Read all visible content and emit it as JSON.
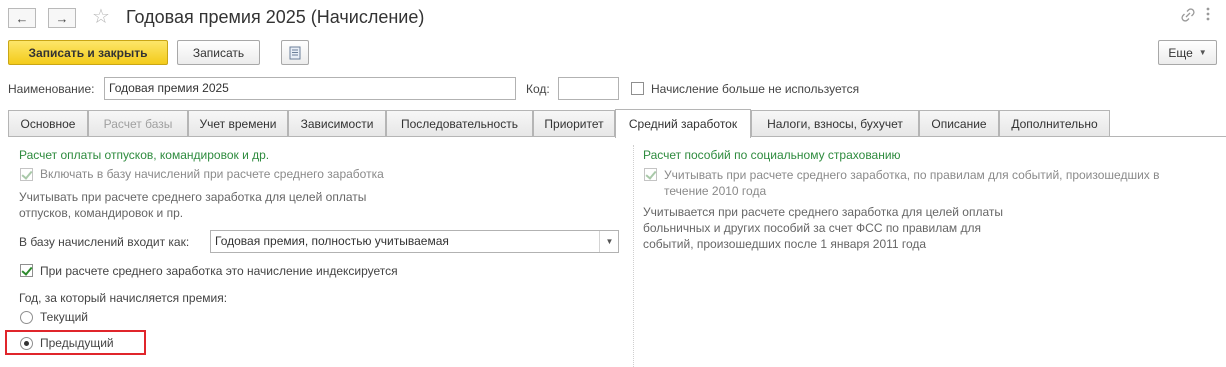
{
  "window": {
    "title": "Годовая премия 2025 (Начисление)",
    "icons": [
      "arrow-left-icon",
      "arrow-right-icon",
      "star-icon",
      "link-icon",
      "more-vertical-icon",
      "maximize-icon",
      "close-icon"
    ]
  },
  "toolbar": {
    "save_close_label": "Записать и закрыть",
    "save_label": "Записать",
    "more_label": "Еще",
    "accent_color": "#f3cb1a"
  },
  "header": {
    "name_label": "Наименование:",
    "name_value": "Годовая премия 2025",
    "code_label": "Код:",
    "code_value": "",
    "unused_label": "Начисление больше не используется",
    "unused_checked": false
  },
  "tabs": [
    {
      "label": "Основное",
      "state": "normal"
    },
    {
      "label": "Расчет базы",
      "state": "disabled"
    },
    {
      "label": "Учет времени",
      "state": "normal"
    },
    {
      "label": "Зависимости",
      "state": "normal"
    },
    {
      "label": "Последовательность",
      "state": "normal"
    },
    {
      "label": "Приоритет",
      "state": "normal"
    },
    {
      "label": "Средний заработок",
      "state": "active"
    },
    {
      "label": "Налоги, взносы, бухучет",
      "state": "normal"
    },
    {
      "label": "Описание",
      "state": "normal"
    },
    {
      "label": "Дополнительно",
      "state": "normal"
    }
  ],
  "left": {
    "section_title": "Расчет оплаты отпусков, командировок и др.",
    "include_label": "Включать в базу начислений при расчете среднего заработка",
    "include_checked": true,
    "note_line1": "Учитывать при расчете среднего заработка для целей оплаты",
    "note_line2": "отпусков, командировок и пр.",
    "base_label": "В базу начислений входит как:",
    "base_value": "Годовая премия, полностью учитываемая",
    "index_label": "При расчете среднего заработка это начисление индексируется",
    "index_checked": true,
    "year_label": "Год, за который начисляется премия:",
    "radio_current": "Текущий",
    "radio_previous": "Предыдущий",
    "selected_radio": "Предыдущий"
  },
  "right": {
    "section_title": "Расчет пособий по социальному страхованию",
    "rules_label_line1": "Учитывать при расчете среднего заработка, по правилам для событий, произошедших в",
    "rules_label_line2": "течение 2010 года",
    "rules_checked": true,
    "note_line1": "Учитывается при расчете среднего заработка для целей оплаты",
    "note_line2": "больничных и других пособий за счет ФСС по правилам для",
    "note_line3": "событий, произошедших после 1 января 2011 года"
  },
  "colors": {
    "section_green": "#2e8b3e",
    "highlight_red": "#e0252b"
  }
}
